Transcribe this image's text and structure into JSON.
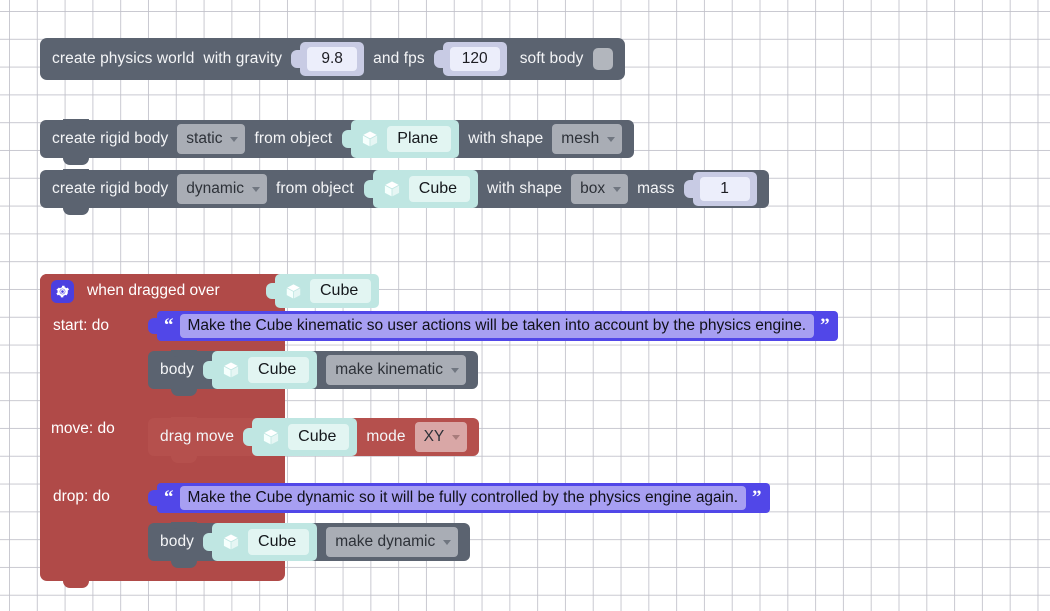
{
  "canvas": {
    "grid_color": "#c3c3cb",
    "background": "#ffffff"
  },
  "palette": {
    "statement_block": "#5b6370",
    "event_block": "#b04a48",
    "inner_red_block": "#b5504d",
    "object_block": "#bfe6e2",
    "object_field": "#e2f5f2",
    "number_block": "#c8cbe4",
    "number_field": "#eceefb",
    "dropdown": "#a9adb5",
    "dropdown_pink": "#d9a7a6",
    "comment_block": "#5147e8",
    "comment_text_field": "#a79ff2",
    "gear_badge": "#4b3fe0"
  },
  "blocks": {
    "physics_world": {
      "label_create": "create physics world",
      "label_gravity": "with gravity",
      "gravity_value": "9.8",
      "label_fps": "and fps",
      "fps_value": "120",
      "label_soft_body": "soft body",
      "soft_body_checked": false
    },
    "rigid_body_static": {
      "label_create": "create rigid body",
      "body_type": "static",
      "label_from_object": "from object",
      "object_name": "Plane",
      "object_icon": "cube-icon",
      "label_with_shape": "with shape",
      "shape": "mesh"
    },
    "rigid_body_dynamic": {
      "label_create": "create rigid body",
      "body_type": "dynamic",
      "label_from_object": "from object",
      "object_name": "Cube",
      "object_icon": "cube-icon",
      "label_with_shape": "with shape",
      "shape": "box",
      "label_mass": "mass",
      "mass_value": "1"
    },
    "when_dragged_over": {
      "gear_icon": "gear-icon",
      "label": "when dragged over",
      "object_name": "Cube",
      "object_icon": "cube-icon",
      "branches": {
        "start": {
          "label": "start: do",
          "comment": "Make the Cube kinematic so user actions will be taken into account by the physics engine.",
          "quote_open": "“",
          "quote_close": "”",
          "body_label": "body",
          "body_object": "Cube",
          "body_action": "make kinematic"
        },
        "move": {
          "label": "move: do",
          "action_label": "drag move",
          "action_object": "Cube",
          "mode_label": "mode",
          "mode_value": "XY"
        },
        "drop": {
          "label": "drop: do",
          "comment": "Make the Cube dynamic so it will be fully controlled by the physics engine again.",
          "quote_open": "“",
          "quote_close": "”",
          "body_label": "body",
          "body_object": "Cube",
          "body_action": "make dynamic"
        }
      }
    }
  }
}
